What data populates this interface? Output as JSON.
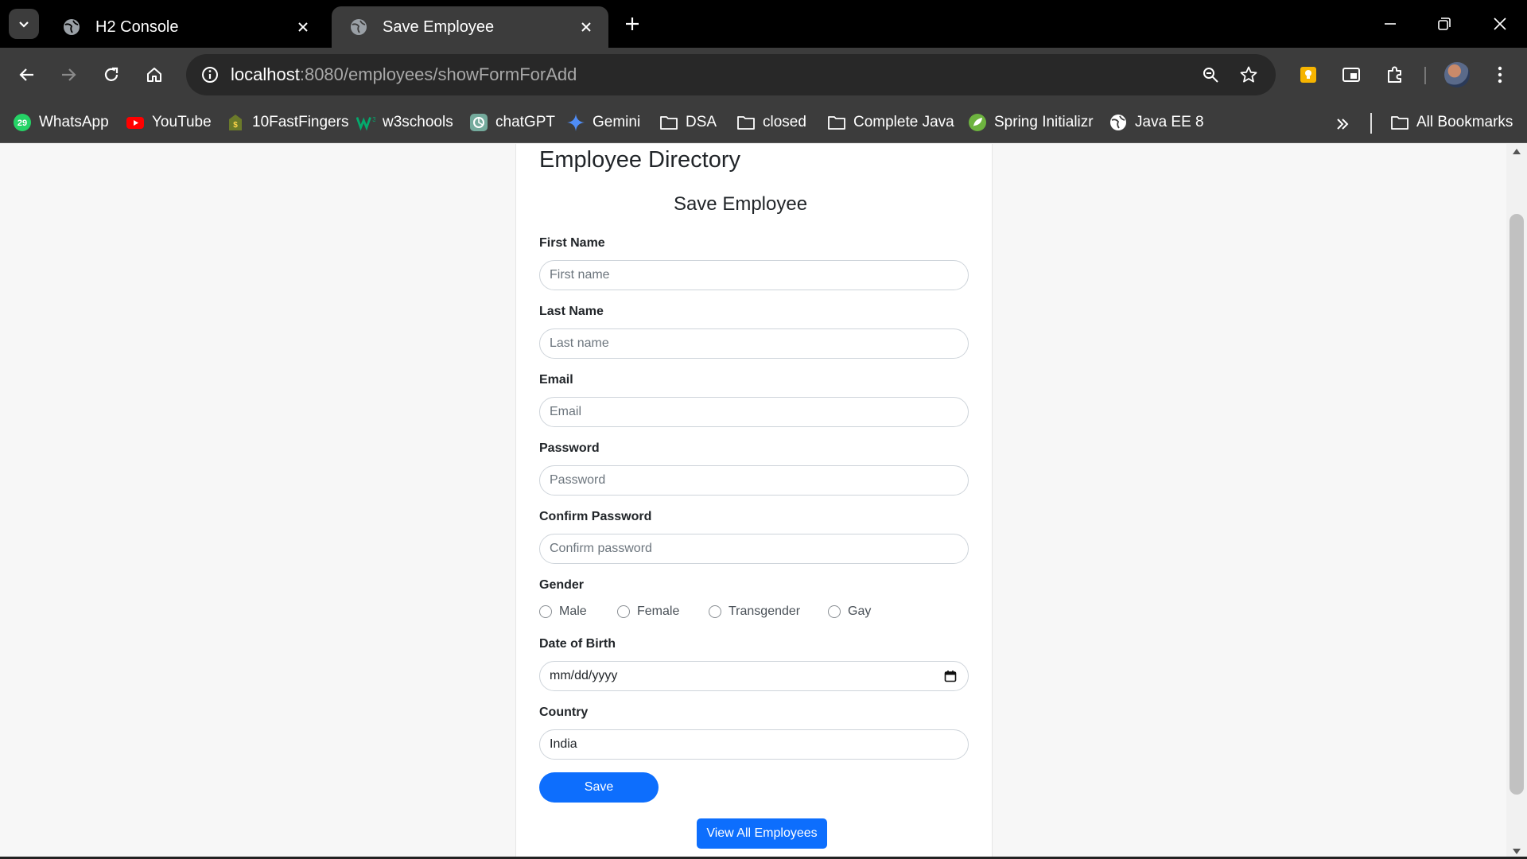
{
  "browser": {
    "tabs": [
      {
        "title": "H2 Console",
        "active": false
      },
      {
        "title": "Save Employee",
        "active": true
      }
    ],
    "address": {
      "host": "localhost",
      "rest": ":8080/employees/showFormForAdd"
    },
    "bookmarks": [
      {
        "label": "WhatsApp",
        "icon": "whatsapp-icon"
      },
      {
        "label": "YouTube",
        "icon": "youtube-icon"
      },
      {
        "label": "10FastFingers",
        "icon": "10fastfingers-icon"
      },
      {
        "label": "w3schools",
        "icon": "w3schools-icon"
      },
      {
        "label": "chatGPT",
        "icon": "chatgpt-icon"
      },
      {
        "label": "Gemini",
        "icon": "gemini-icon"
      },
      {
        "label": "DSA",
        "icon": "folder-icon"
      },
      {
        "label": "closed",
        "icon": "folder-icon"
      },
      {
        "label": "Complete Java",
        "icon": "folder-icon"
      },
      {
        "label": "Spring Initializr",
        "icon": "spring-icon"
      },
      {
        "label": "Java EE 8",
        "icon": "globe-icon"
      }
    ],
    "all_bookmarks": "All Bookmarks",
    "whatsapp_badge": "29"
  },
  "page": {
    "directory_title": "Employee Directory",
    "form_title": "Save Employee",
    "fields": {
      "first_name": {
        "label": "First Name",
        "placeholder": "First name"
      },
      "last_name": {
        "label": "Last Name",
        "placeholder": "Last name"
      },
      "email": {
        "label": "Email",
        "placeholder": "Email"
      },
      "password": {
        "label": "Password",
        "placeholder": "Password"
      },
      "confirm_password": {
        "label": "Confirm Password",
        "placeholder": "Confirm password"
      },
      "gender": {
        "label": "Gender",
        "options": [
          "Male",
          "Female",
          "Transgender",
          "Gay"
        ]
      },
      "dob": {
        "label": "Date of Birth",
        "placeholder": "mm/dd/yyyy"
      },
      "country": {
        "label": "Country",
        "value": "India"
      }
    },
    "save_label": "Save",
    "view_all_label": "View All Employees"
  },
  "colors": {
    "primary": "#0d6efd",
    "tabstrip": "#000000",
    "toolbar": "#3c3c3c",
    "omnibox": "#282828"
  }
}
